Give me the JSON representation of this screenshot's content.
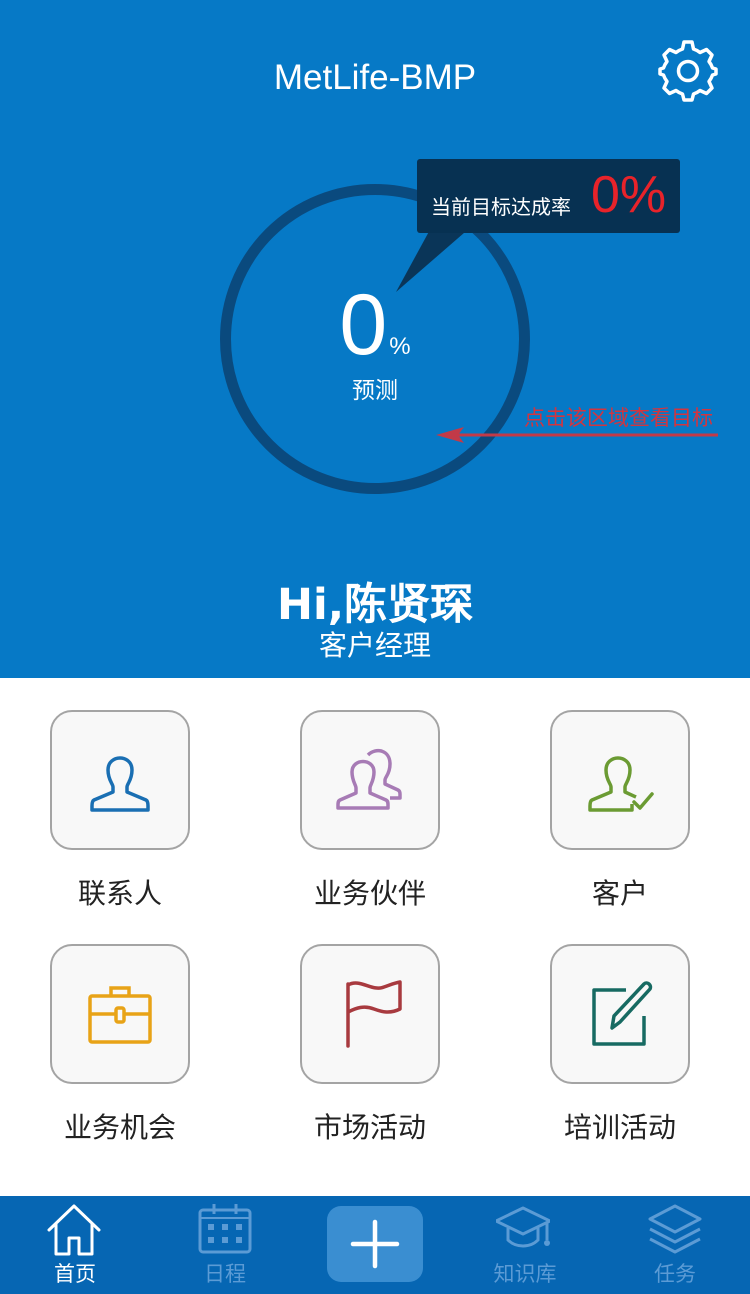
{
  "header": {
    "app_title": "MetLife-BMP",
    "settings_icon": "gear-icon"
  },
  "goal": {
    "ring_value": "0",
    "ring_unit": "%",
    "ring_label": "预测",
    "tooltip_label": "当前目标达成率",
    "tooltip_value": "0%",
    "annotation": "点击该区域查看目标"
  },
  "user": {
    "greeting": "Hi,陈贤琛",
    "role": "客户经理"
  },
  "menu": {
    "items": [
      {
        "label": "联系人",
        "icon": "person-icon",
        "color": "#1a6fb3"
      },
      {
        "label": "业务伙伴",
        "icon": "partners-icon",
        "color": "#a77bb5"
      },
      {
        "label": "客户",
        "icon": "customer-check-icon",
        "color": "#6b9b33"
      },
      {
        "label": "业务机会",
        "icon": "briefcase-icon",
        "color": "#e8a317"
      },
      {
        "label": "市场活动",
        "icon": "flag-icon",
        "color": "#a83a3f"
      },
      {
        "label": "培训活动",
        "icon": "edit-icon",
        "color": "#176a62"
      }
    ]
  },
  "tabbar": {
    "tabs": [
      {
        "label": "首页",
        "icon": "home-icon",
        "active": true
      },
      {
        "label": "日程",
        "icon": "calendar-icon",
        "active": false
      },
      {
        "label": "",
        "icon": "plus-icon",
        "active": false
      },
      {
        "label": "知识库",
        "icon": "graduation-cap-icon",
        "active": false
      },
      {
        "label": "任务",
        "icon": "layers-icon",
        "active": false
      }
    ]
  },
  "colors": {
    "header_bg": "#0679c6",
    "ring": "#0a4a7e",
    "tooltip_bg": "#073152",
    "tooltip_value": "#e8232a",
    "annotation": "#d2353f",
    "tabbar_bg": "#0666b3",
    "tab_active": "#ffffff",
    "tab_inactive": "#5b9bd5"
  }
}
